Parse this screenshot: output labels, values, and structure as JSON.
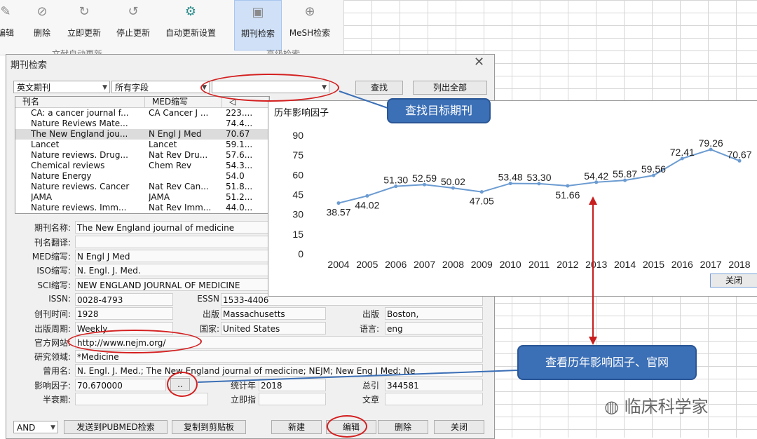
{
  "ribbon": {
    "buttons": [
      "编辑",
      "删除",
      "立即更新",
      "停止更新",
      "自动更新设置",
      "期刊检索",
      "MeSH检索"
    ],
    "groups": [
      "文献自动更新",
      "高级检索"
    ]
  },
  "dialog": {
    "title": "期刊检索",
    "close": "✕",
    "type_select": "英文期刊",
    "field_select": "所有字段",
    "search_value": "",
    "search_btn": "查找",
    "list_all_btn": "列出全部",
    "list": {
      "headers": [
        "刊名",
        "MED缩写"
      ],
      "rows": [
        [
          "CA: a cancer journal f...",
          "CA Cancer J ...",
          "223...."
        ],
        [
          "Nature Reviews Mate...",
          "",
          "74.4..."
        ],
        [
          "The New England jou...",
          "N Engl J Med",
          "70.67"
        ],
        [
          "Lancet",
          "Lancet",
          "59.1..."
        ],
        [
          "Nature reviews. Drug...",
          "Nat Rev Dru...",
          "57.6..."
        ],
        [
          "Chemical reviews",
          "Chem Rev",
          "54.3..."
        ],
        [
          "Nature Energy",
          "",
          "54.0"
        ],
        [
          "Nature reviews. Cancer",
          "Nat Rev Can...",
          "51.8..."
        ],
        [
          "JAMA",
          "JAMA",
          "51.2..."
        ],
        [
          "Nature reviews. Imm...",
          "Nat Rev Imm...",
          "44.0..."
        ]
      ]
    },
    "labels": {
      "name": "期刊名称:",
      "trans": "刊名翻译:",
      "med": "MED缩写:",
      "iso": "ISO缩写:",
      "sci": "SCI缩写:",
      "issn": "ISSN:",
      "essn": "ESSN",
      "founded": "创刊时间:",
      "pub1": "出版",
      "pub2": "出版",
      "period": "出版周期:",
      "country": "国家:",
      "lang": "语言:",
      "website": "官方网站:",
      "field": "研究领域:",
      "former": "曾用名:",
      "if": "影响因子:",
      "stat_year": "统计年",
      "total_cite": "总引",
      "halflife": "半衰期:",
      "immediacy": "立即指",
      "articles": "文章"
    },
    "values": {
      "name": "The New England journal of medicine",
      "med": "N Engl J Med",
      "iso": "N. Engl. J. Med.",
      "sci": "NEW ENGLAND JOURNAL OF MEDICINE",
      "issn": "0028-4793",
      "essn": "1533-4406",
      "founded": "1928",
      "pub_place": "Massachusetts",
      "pub_city": "Boston,",
      "period": "Weekly",
      "country": "United States",
      "lang": "eng",
      "website": "http://www.nejm.org/",
      "field": "*Medicine",
      "former": "N. Engl. J. Med.; The New England journal of medicine; NEJM; New Eng J Med; Ne",
      "if": "70.670000",
      "if_btn": "..",
      "stat_year": "2018",
      "total_cite": "344581"
    },
    "bottom": {
      "and": "AND",
      "send": "发送到PUBMED检索",
      "copy": "复制到剪贴板",
      "new": "新建",
      "edit": "编辑",
      "delete": "删除",
      "close": "关闭"
    }
  },
  "chart_panel": {
    "close_btn": "关闭"
  },
  "chart_data": {
    "type": "line",
    "title": "历年影响因子",
    "x": [
      "2004",
      "2005",
      "2006",
      "2007",
      "2008",
      "2009",
      "2010",
      "2011",
      "2012",
      "2013",
      "2014",
      "2015",
      "2016",
      "2017",
      "2018"
    ],
    "values": [
      38.57,
      44.02,
      51.3,
      52.59,
      50.02,
      47.05,
      53.48,
      53.3,
      51.66,
      54.42,
      55.87,
      59.56,
      72.41,
      79.26,
      70.67
    ],
    "labels": [
      "38.57",
      "44.02",
      "51.30",
      "52.59",
      "50.02",
      "47.05",
      "53.48",
      "53.30",
      "51.66",
      "54.42",
      "55.87",
      "59.56",
      "72.41",
      "79.26",
      "70.67"
    ],
    "yticks": [
      "90",
      "75",
      "60",
      "45",
      "30",
      "15",
      "0"
    ],
    "ylim": [
      0,
      90
    ],
    "color": "#6b9bd1"
  },
  "callouts": {
    "search": "查找目标期刊",
    "history": "查看历年影响因子、官网"
  },
  "watermark": "临床科学家"
}
